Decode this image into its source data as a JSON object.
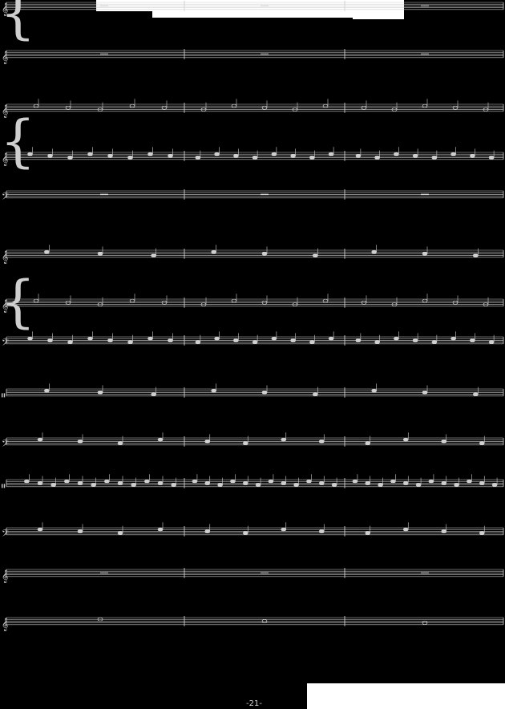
{
  "colors": {
    "background": "#000000",
    "ink": "#cfcfcf",
    "blank": "#ffffff"
  },
  "page": {
    "number": "-21-"
  },
  "score": {
    "measures_per_system": 3,
    "staves": [
      {
        "clef": "treble",
        "note_pattern": "rest"
      },
      {
        "clef": "treble",
        "note_pattern": "rest"
      },
      {
        "clef": "treble",
        "note_pattern": "melody"
      },
      {
        "clef": "treble",
        "note_pattern": "eighths"
      },
      {
        "clef": "bass",
        "note_pattern": "rest"
      },
      {
        "clef": "treble",
        "note_pattern": "sparse"
      },
      {
        "clef": "treble",
        "note_pattern": "melody"
      },
      {
        "clef": "bass",
        "note_pattern": "eighths"
      },
      {
        "clef": "percussion",
        "note_pattern": "sparse"
      },
      {
        "clef": "bass",
        "note_pattern": "quarters"
      },
      {
        "clef": "percussion",
        "note_pattern": "hihat"
      },
      {
        "clef": "bass",
        "note_pattern": "quarters"
      },
      {
        "clef": "treble",
        "note_pattern": "rest"
      },
      {
        "clef": "treble",
        "note_pattern": "whole"
      }
    ]
  }
}
